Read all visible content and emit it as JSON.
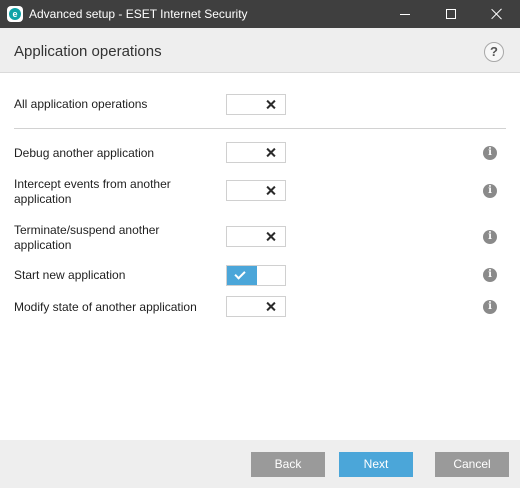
{
  "window": {
    "title": "Advanced setup - ESET Internet Security",
    "app_icon_letter": "e"
  },
  "header": {
    "title": "Application operations",
    "help_glyph": "?"
  },
  "master": {
    "label": "All application operations",
    "enabled": false
  },
  "rows": [
    {
      "label": "Debug another application",
      "enabled": false
    },
    {
      "label": "Intercept events from another application",
      "enabled": false
    },
    {
      "label": "Terminate/suspend another application",
      "enabled": false
    },
    {
      "label": "Start new application",
      "enabled": true
    },
    {
      "label": "Modify state of another application",
      "enabled": false
    }
  ],
  "info_glyph": "i",
  "footer": {
    "back_label": "Back",
    "next_label": "Next",
    "cancel_label": "Cancel"
  },
  "colors": {
    "titlebar": "#3f3f3f",
    "accent": "#4ba6d9",
    "panel": "#eeeeee",
    "secondary_button": "#9a9a9a",
    "brand": "#0fa3a7"
  },
  "icons": {
    "app": "eset-logo-icon",
    "minimize": "minimize-icon",
    "maximize": "maximize-icon",
    "close": "close-icon",
    "help": "help-icon",
    "info": "info-icon",
    "toggle_off": "x-icon",
    "toggle_on": "checkmark-icon"
  }
}
